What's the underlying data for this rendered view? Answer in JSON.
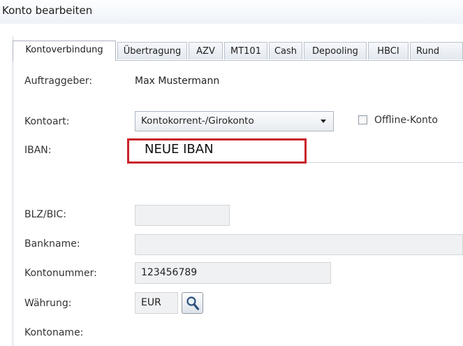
{
  "window": {
    "title": "Konto bearbeiten"
  },
  "tabs": [
    {
      "label": "Kontoverbindung",
      "active": true
    },
    {
      "label": "Übertragung",
      "active": false
    },
    {
      "label": "AZV",
      "active": false
    },
    {
      "label": "MT101",
      "active": false
    },
    {
      "label": "Cash",
      "active": false
    },
    {
      "label": "Depooling",
      "active": false
    },
    {
      "label": "HBCI",
      "active": false
    },
    {
      "label": "Rund",
      "active": false
    }
  ],
  "form": {
    "auftraggeber": {
      "label": "Auftraggeber:",
      "value": "Max Mustermann"
    },
    "kontoart": {
      "label": "Kontoart:",
      "value": "Kontokorrent-/Girokonto"
    },
    "offline": {
      "label": "Offline-Konto",
      "checked": false
    },
    "iban": {
      "label": "IBAN:",
      "value": "NEUE IBAN"
    },
    "blz_bic": {
      "label": "BLZ/BIC:",
      "value": ""
    },
    "bankname": {
      "label": "Bankname:",
      "value": ""
    },
    "kontonummer": {
      "label": "Kontonummer:",
      "value": "123456789"
    },
    "waehrung": {
      "label": "Währung:",
      "value": "EUR"
    },
    "kontoname": {
      "label": "Kontoname:",
      "value": ""
    }
  },
  "colors": {
    "highlight_border": "#c8232b"
  },
  "icons": {
    "search": "magnifier-icon",
    "dropdown": "chevron-down-icon"
  }
}
